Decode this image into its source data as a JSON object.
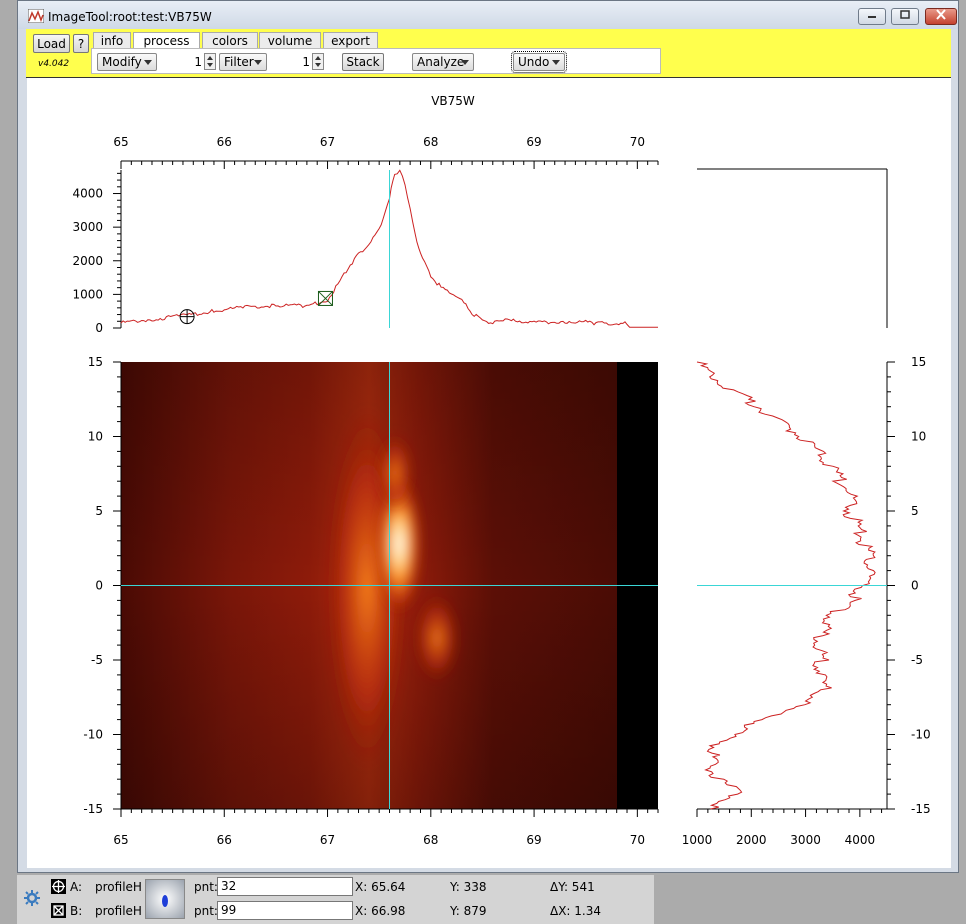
{
  "window": {
    "title": "ImageTool:root:test:VB75W"
  },
  "toolbar": {
    "load_label": "Load",
    "help_label": "?",
    "version": "v4.042",
    "tabs": [
      "info",
      "process",
      "colors",
      "volume",
      "export"
    ],
    "active_tab": "process",
    "modify_label": "Modify",
    "filter_count": "1",
    "filter_label": "Filter",
    "stack_count": "1",
    "stack_label": "Stack",
    "analyze_label": "Analyze",
    "undo_label": "Undo"
  },
  "plot": {
    "title": "VB75W",
    "colors": {
      "profile": "#cc2222",
      "cursor": "#3ad6d6",
      "bg": "#ffffff"
    },
    "cursor": {
      "x": 67.6,
      "y": 0
    },
    "marker_a": {
      "x": 65.64,
      "y": 338
    },
    "marker_b": {
      "x": 66.98,
      "y": 879
    }
  },
  "chart_data": [
    {
      "type": "line",
      "name": "horizontal profile",
      "x_ticks": [
        "65",
        "66",
        "67",
        "68",
        "69",
        "70"
      ],
      "y_ticks": [
        "0",
        "1000",
        "2000",
        "3000",
        "4000"
      ],
      "xlim": [
        65,
        70.2
      ],
      "ylim": [
        0,
        4700
      ],
      "x": [
        65.0,
        65.3,
        65.6,
        65.9,
        66.2,
        66.5,
        66.8,
        67.0,
        67.1,
        67.2,
        67.3,
        67.4,
        67.5,
        67.6,
        67.65,
        67.7,
        67.75,
        67.8,
        67.85,
        67.9,
        68.0,
        68.1,
        68.2,
        68.3,
        68.4,
        68.5,
        68.6,
        68.8,
        69.0,
        69.3,
        69.6,
        69.9,
        69.95,
        70.2
      ],
      "y": [
        150,
        260,
        360,
        500,
        620,
        670,
        650,
        820,
        1300,
        1800,
        2200,
        2500,
        2900,
        3900,
        4600,
        4650,
        4300,
        3500,
        2800,
        2200,
        1550,
        1200,
        1050,
        800,
        450,
        200,
        180,
        240,
        170,
        200,
        150,
        140,
        20,
        20
      ]
    },
    {
      "type": "image",
      "name": "intensity map",
      "x_ticks": [
        "65",
        "66",
        "67",
        "68",
        "69",
        "70"
      ],
      "y_ticks": [
        "15",
        "10",
        "5",
        "0",
        "-5",
        "-10",
        "-15"
      ],
      "xlim": [
        65,
        70.2
      ],
      "ylim": [
        -15,
        15
      ]
    },
    {
      "type": "line",
      "name": "vertical profile",
      "x_ticks": [
        "1000",
        "2000",
        "3000",
        "4000"
      ],
      "y_ticks": [
        "15",
        "10",
        "5",
        "0",
        "-5",
        "-10",
        "-15"
      ],
      "xlim": [
        1000,
        4500
      ],
      "ylim": [
        -15,
        15
      ],
      "y": [
        15,
        14,
        13,
        12,
        11,
        10,
        9,
        8,
        7,
        6,
        5,
        4,
        3,
        2,
        1,
        0,
        -1,
        -2,
        -3,
        -4,
        -5,
        -6,
        -7,
        -8,
        -9,
        -10,
        -11,
        -12,
        -13,
        -14,
        -15
      ],
      "x": [
        1000,
        1300,
        1700,
        2150,
        2500,
        2950,
        3200,
        3450,
        3650,
        3850,
        3800,
        3950,
        4050,
        4200,
        4150,
        4100,
        3850,
        3500,
        3300,
        3250,
        3300,
        3250,
        3350,
        2900,
        2200,
        1650,
        1300,
        1250,
        1400,
        1800,
        1250
      ]
    }
  ],
  "status": {
    "a_label": "A:",
    "a_wave": "profileH",
    "a_pnt_label": "pnt:",
    "a_pnt": "32",
    "a_x": "X: 65.64",
    "a_y": "Y: 338",
    "dy": "ΔY: 541",
    "b_label": "B:",
    "b_wave": "profileH",
    "b_pnt_label": "pnt:",
    "b_pnt": "99",
    "b_x": "X: 66.98",
    "b_y": "Y: 879",
    "dx": "ΔX: 1.34"
  }
}
